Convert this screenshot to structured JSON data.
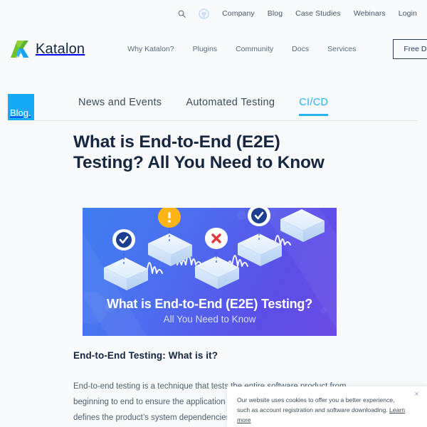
{
  "utility_bar": {
    "search_icon": "search-icon",
    "github_icon": "github-icon",
    "links": [
      {
        "label": "Company"
      },
      {
        "label": "Blog"
      },
      {
        "label": "Case Studies"
      },
      {
        "label": "Webinars"
      },
      {
        "label": "Login"
      }
    ]
  },
  "brand": {
    "name": "Katalon",
    "logo_icon": "katalon-k-logo-icon",
    "logo_green": "#7ac943",
    "logo_blue": "#1ba0ee"
  },
  "main_nav": {
    "links": [
      {
        "label": "Why Katalon?"
      },
      {
        "label": "Plugins"
      },
      {
        "label": "Community"
      },
      {
        "label": "Docs"
      },
      {
        "label": "Services"
      }
    ],
    "cta_label": "Free Download"
  },
  "blog_bar": {
    "badge_label": "Blog.",
    "badge_color": "#14aaf5",
    "accent_color": "#29b3f0",
    "tabs": [
      {
        "label": "News and Events",
        "active": false
      },
      {
        "label": "Automated Testing",
        "active": false
      },
      {
        "label": "CI/CD",
        "active": true
      }
    ]
  },
  "article": {
    "title": "What is End-to-End (E2E) Testing? All You Need to Know",
    "hero": {
      "caption_line1": "What is End-to-End (E2E) Testing?",
      "caption_line2": "All You Need to Know",
      "alt": "Isometric blue boxes connected by white signal waves with check, warning and error map pins",
      "markers": [
        {
          "type": "check-marker",
          "state": "pass"
        },
        {
          "type": "warning-marker",
          "state": "warning"
        },
        {
          "type": "error-marker",
          "state": "fail"
        },
        {
          "type": "check-marker",
          "state": "pass"
        }
      ]
    },
    "section_heading": "End-to-End Testing: What is it?",
    "body_paragraph": "End-to-end testing is a technique that tests the entire software product from beginning to end to ensure the application flow behaves as expected. It defines the product’s system dependencies"
  },
  "cookie_banner": {
    "text": "Our website uses cookies to offer you a better experience, such as account registration and software downloading.",
    "link_label": "Learn more",
    "close_icon": "close-icon",
    "close_label": "×"
  }
}
